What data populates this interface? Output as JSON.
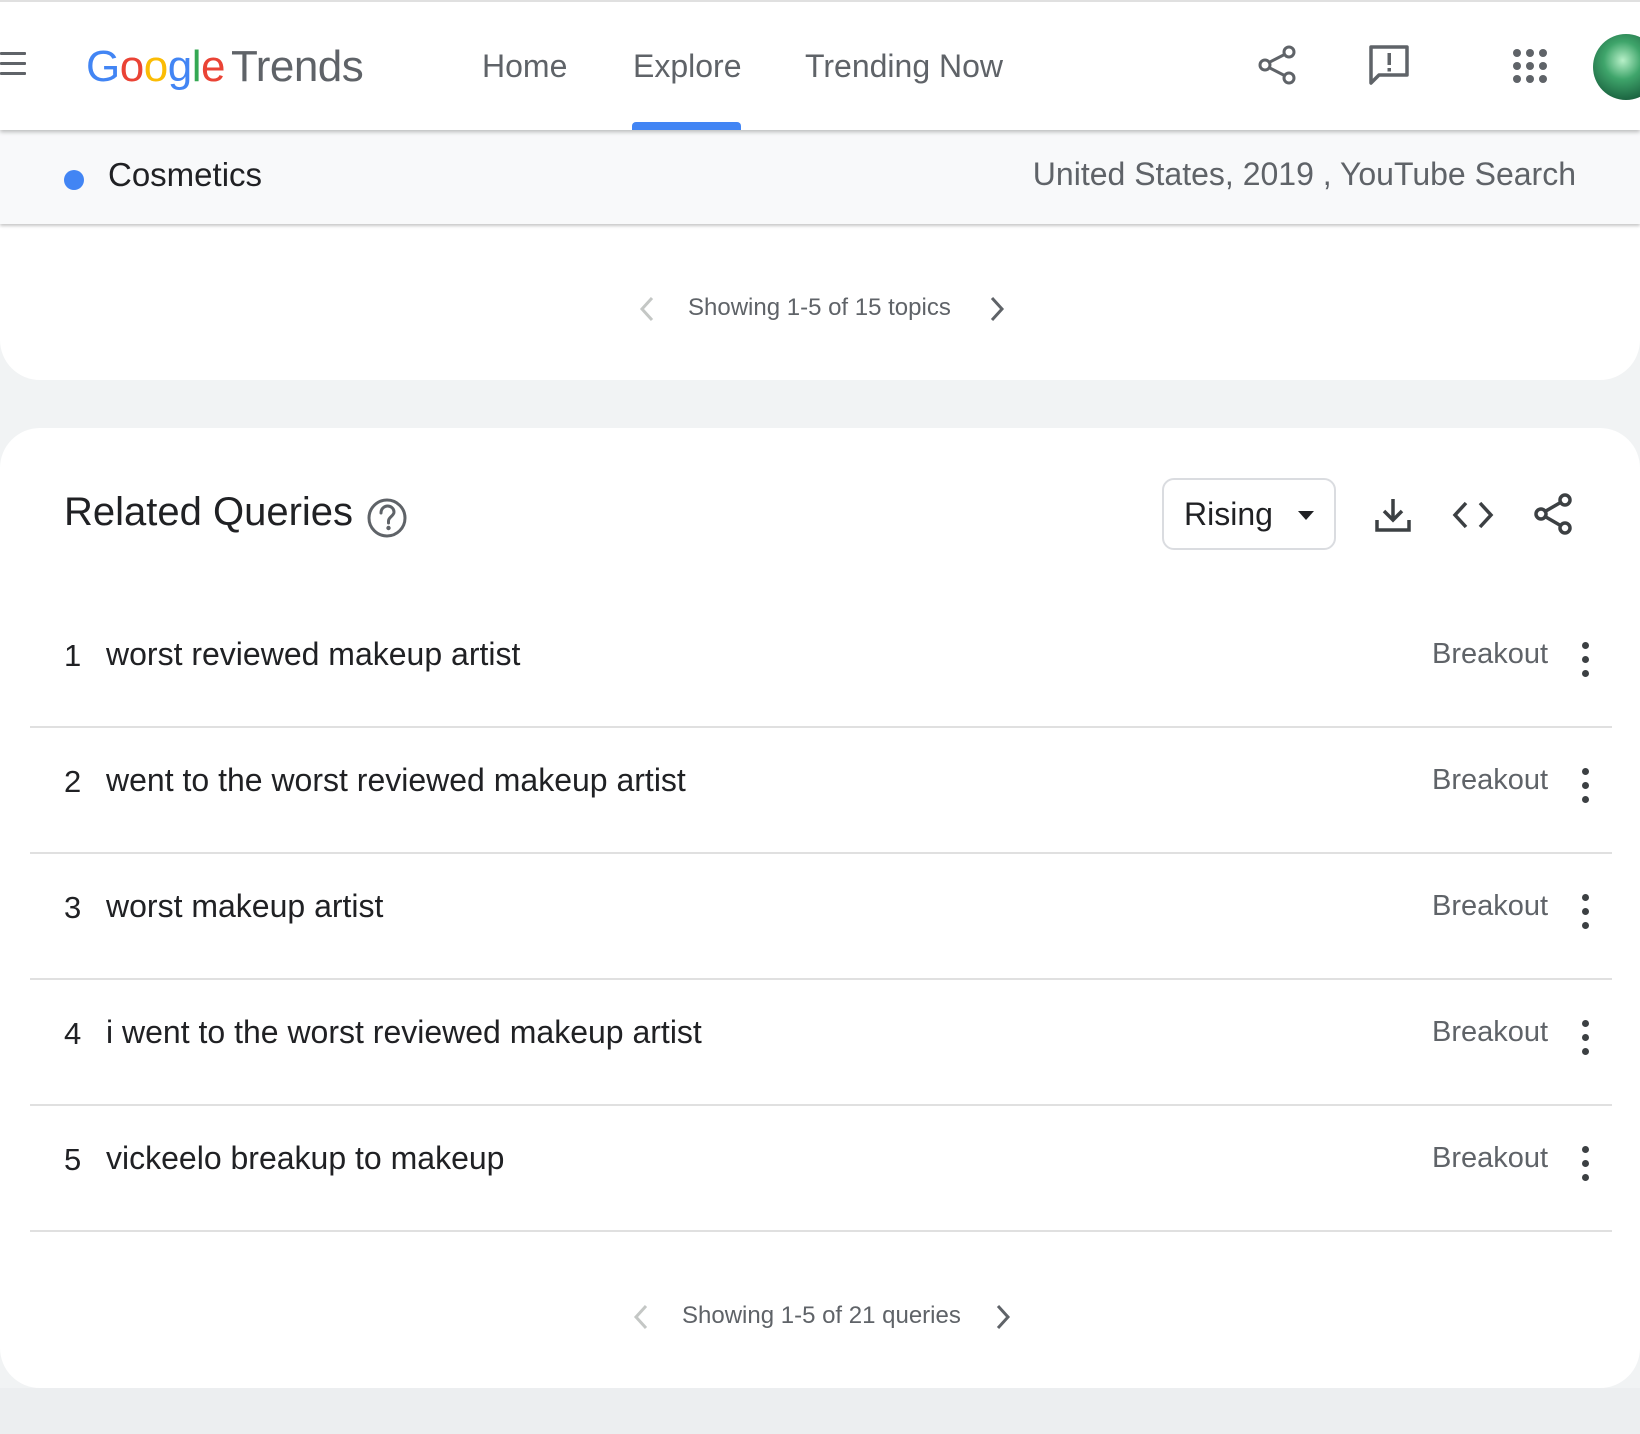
{
  "header": {
    "logo": {
      "letters": [
        "G",
        "o",
        "o",
        "g",
        "l",
        "e"
      ],
      "product": "Trends"
    },
    "tabs": [
      {
        "label": "Home"
      },
      {
        "label": "Explore",
        "active": true
      },
      {
        "label": "Trending Now"
      }
    ],
    "icons": [
      "share-icon",
      "feedback-icon",
      "apps-grid-icon",
      "avatar"
    ]
  },
  "subheader": {
    "term": "Cosmetics",
    "term_color": "#4285f4",
    "context": "United States, 2019 , YouTube Search"
  },
  "topics_pager": {
    "text": "Showing 1-5 of 15 topics"
  },
  "related_queries": {
    "title": "Related Queries",
    "dropdown": {
      "selected": "Rising"
    },
    "rows": [
      {
        "rank": "1",
        "query": "worst reviewed makeup artist",
        "value": "Breakout"
      },
      {
        "rank": "2",
        "query": "went to the worst reviewed makeup artist",
        "value": "Breakout"
      },
      {
        "rank": "3",
        "query": "worst makeup artist",
        "value": "Breakout"
      },
      {
        "rank": "4",
        "query": "i went to the worst reviewed makeup artist",
        "value": "Breakout"
      },
      {
        "rank": "5",
        "query": "vickeelo breakup to makeup",
        "value": "Breakout"
      }
    ],
    "pager": {
      "text": "Showing 1-5 of 21 queries"
    }
  },
  "colors": {
    "accent": "#4285f4",
    "text": "#202124",
    "muted": "#5f6368"
  }
}
